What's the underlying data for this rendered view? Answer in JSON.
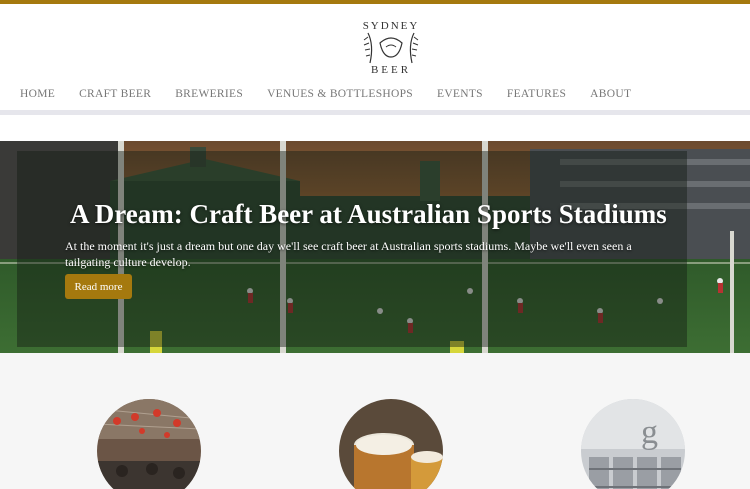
{
  "site": {
    "logo_text": "SYDNEY BEER",
    "brand_color": "#a5790e"
  },
  "nav": {
    "items": [
      {
        "label": "HOME"
      },
      {
        "label": "CRAFT BEER"
      },
      {
        "label": "BREWERIES"
      },
      {
        "label": "VENUES & BOTTLESHOPS"
      },
      {
        "label": "EVENTS"
      },
      {
        "label": "FEATURES"
      },
      {
        "label": "ABOUT"
      }
    ]
  },
  "hero": {
    "title": "A Dream: Craft Beer at Australian Sports Stadiums",
    "text": "At the moment it's just a dream but one day we'll see craft beer at Australian sports stadiums. Maybe we'll even seen a tailgating culture develop.",
    "button_label": "Read more"
  },
  "features": {
    "images": [
      {
        "icon": "lanterns-venue-photo"
      },
      {
        "icon": "beer-glasses-photo"
      },
      {
        "icon": "kegs-photo"
      }
    ]
  }
}
